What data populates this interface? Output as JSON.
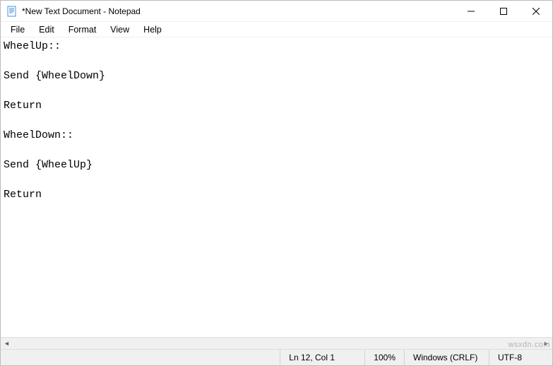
{
  "titlebar": {
    "title": "*New Text Document - Notepad"
  },
  "menu": {
    "file": "File",
    "edit": "Edit",
    "format": "Format",
    "view": "View",
    "help": "Help"
  },
  "editor": {
    "content": "WheelUp::\n\nSend {WheelDown}\n\nReturn\n\nWheelDown::\n\nSend {WheelUp}\n\nReturn"
  },
  "status": {
    "position": "Ln 12, Col 1",
    "zoom": "100%",
    "line_ending": "Windows (CRLF)",
    "encoding": "UTF-8"
  },
  "watermark": "wsxdn.com"
}
